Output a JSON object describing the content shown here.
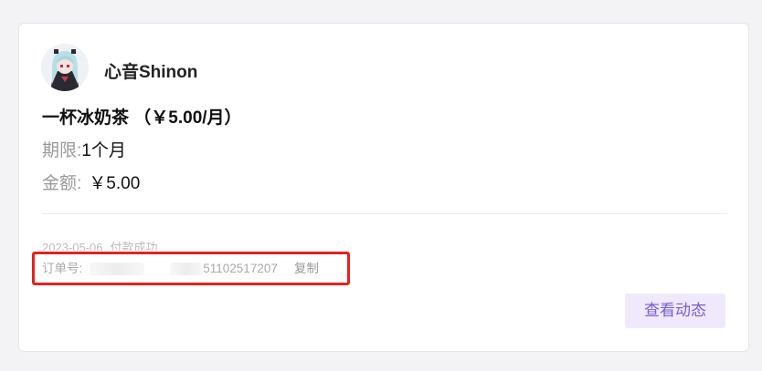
{
  "creator": {
    "name": "心音Shinon"
  },
  "plan": {
    "title": "一杯冰奶茶 （￥5.00/月）"
  },
  "term": {
    "label": "期限:",
    "value": "1个月"
  },
  "amount": {
    "label": "金额:",
    "value": "￥5.00"
  },
  "payment": {
    "date": "2023-05-06",
    "status": "付款成功"
  },
  "order": {
    "label": "订单号:",
    "number_tail": "51102517207",
    "copy_label": "复制"
  },
  "actions": {
    "view_activity": "查看动态"
  },
  "colors": {
    "accent_text": "#7a5bd0",
    "accent_bg": "#efe9fb",
    "highlight": "#e3231c"
  }
}
